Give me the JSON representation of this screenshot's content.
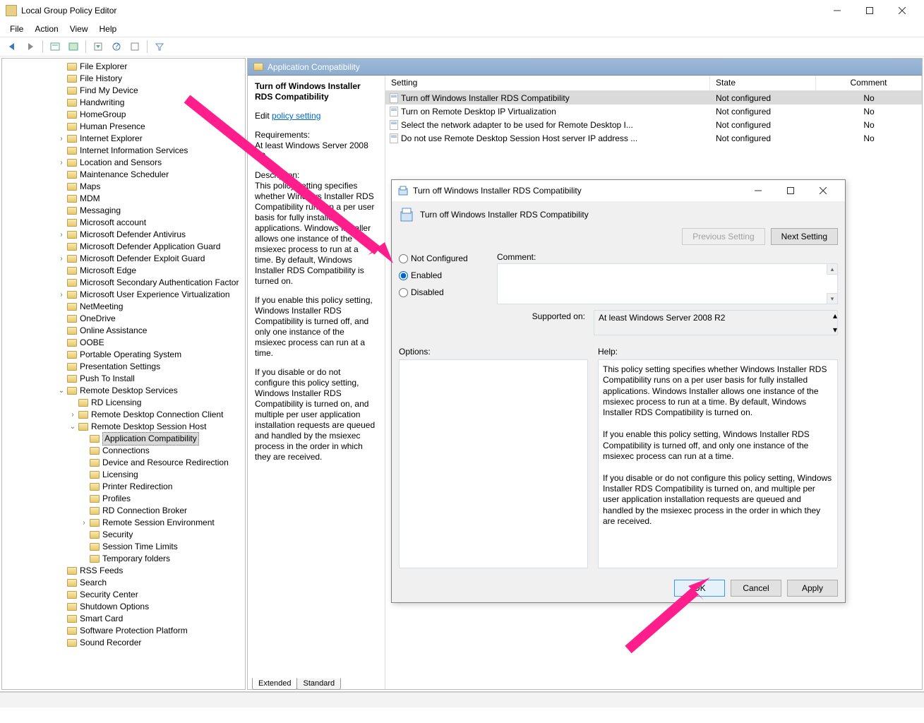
{
  "window": {
    "title": "Local Group Policy Editor"
  },
  "menu": [
    "File",
    "Action",
    "View",
    "Help"
  ],
  "header": {
    "title": "Application Compatibility"
  },
  "tree": [
    {
      "d": 3,
      "c": "",
      "l": "File Explorer"
    },
    {
      "d": 3,
      "c": "",
      "l": "File History"
    },
    {
      "d": 3,
      "c": "",
      "l": "Find My Device"
    },
    {
      "d": 3,
      "c": "",
      "l": "Handwriting"
    },
    {
      "d": 3,
      "c": "",
      "l": "HomeGroup"
    },
    {
      "d": 3,
      "c": "",
      "l": "Human Presence"
    },
    {
      "d": 3,
      "c": ">",
      "l": "Internet Explorer"
    },
    {
      "d": 3,
      "c": "",
      "l": "Internet Information Services"
    },
    {
      "d": 3,
      "c": ">",
      "l": "Location and Sensors"
    },
    {
      "d": 3,
      "c": "",
      "l": "Maintenance Scheduler"
    },
    {
      "d": 3,
      "c": "",
      "l": "Maps"
    },
    {
      "d": 3,
      "c": "",
      "l": "MDM"
    },
    {
      "d": 3,
      "c": "",
      "l": "Messaging"
    },
    {
      "d": 3,
      "c": "",
      "l": "Microsoft account"
    },
    {
      "d": 3,
      "c": ">",
      "l": "Microsoft Defender Antivirus"
    },
    {
      "d": 3,
      "c": "",
      "l": "Microsoft Defender Application Guard"
    },
    {
      "d": 3,
      "c": ">",
      "l": "Microsoft Defender Exploit Guard"
    },
    {
      "d": 3,
      "c": "",
      "l": "Microsoft Edge"
    },
    {
      "d": 3,
      "c": "",
      "l": "Microsoft Secondary Authentication Factor"
    },
    {
      "d": 3,
      "c": ">",
      "l": "Microsoft User Experience Virtualization"
    },
    {
      "d": 3,
      "c": "",
      "l": "NetMeeting"
    },
    {
      "d": 3,
      "c": "",
      "l": "OneDrive"
    },
    {
      "d": 3,
      "c": "",
      "l": "Online Assistance"
    },
    {
      "d": 3,
      "c": "",
      "l": "OOBE"
    },
    {
      "d": 3,
      "c": "",
      "l": "Portable Operating System"
    },
    {
      "d": 3,
      "c": "",
      "l": "Presentation Settings"
    },
    {
      "d": 3,
      "c": "",
      "l": "Push To Install"
    },
    {
      "d": 3,
      "c": "v",
      "l": "Remote Desktop Services"
    },
    {
      "d": 4,
      "c": "",
      "l": "RD Licensing"
    },
    {
      "d": 4,
      "c": ">",
      "l": "Remote Desktop Connection Client"
    },
    {
      "d": 4,
      "c": "v",
      "l": "Remote Desktop Session Host"
    },
    {
      "d": 5,
      "c": "",
      "l": "Application Compatibility",
      "sel": true
    },
    {
      "d": 5,
      "c": "",
      "l": "Connections"
    },
    {
      "d": 5,
      "c": "",
      "l": "Device and Resource Redirection"
    },
    {
      "d": 5,
      "c": "",
      "l": "Licensing"
    },
    {
      "d": 5,
      "c": "",
      "l": "Printer Redirection"
    },
    {
      "d": 5,
      "c": "",
      "l": "Profiles"
    },
    {
      "d": 5,
      "c": "",
      "l": "RD Connection Broker"
    },
    {
      "d": 5,
      "c": ">",
      "l": "Remote Session Environment"
    },
    {
      "d": 5,
      "c": "",
      "l": "Security"
    },
    {
      "d": 5,
      "c": "",
      "l": "Session Time Limits"
    },
    {
      "d": 5,
      "c": "",
      "l": "Temporary folders"
    },
    {
      "d": 3,
      "c": "",
      "l": "RSS Feeds"
    },
    {
      "d": 3,
      "c": "",
      "l": "Search"
    },
    {
      "d": 3,
      "c": "",
      "l": "Security Center"
    },
    {
      "d": 3,
      "c": "",
      "l": "Shutdown Options"
    },
    {
      "d": 3,
      "c": "",
      "l": "Smart Card"
    },
    {
      "d": 3,
      "c": "",
      "l": "Software Protection Platform"
    },
    {
      "d": 3,
      "c": "",
      "l": "Sound Recorder"
    }
  ],
  "columns": {
    "setting": "Setting",
    "state": "State",
    "comment": "Comment"
  },
  "rows": [
    {
      "name": "Turn off Windows Installer RDS Compatibility",
      "state": "Not configured",
      "comment": "No",
      "sel": true
    },
    {
      "name": "Turn on Remote Desktop IP Virtualization",
      "state": "Not configured",
      "comment": "No"
    },
    {
      "name": "Select the network adapter to be used for Remote Desktop I...",
      "state": "Not configured",
      "comment": "No"
    },
    {
      "name": "Do not use Remote Desktop Session Host server IP address ...",
      "state": "Not configured",
      "comment": "No"
    }
  ],
  "desc": {
    "title": "Turn off Windows Installer RDS Compatibility",
    "edit": "Edit ",
    "link": "policy setting",
    "reqLabel": "Requirements:",
    "req": "At least Windows Server 2008 R2",
    "dlabel": "Description:",
    "d1": "This policy setting specifies whether Windows Installer RDS Compatibility runs on a per user basis for fully installed applications. Windows Installer allows one instance of the msiexec process to run at a time. By default, Windows Installer RDS Compatibility is turned on.",
    "d2": "If you enable this policy setting, Windows Installer RDS Compatibility is turned off, and only one instance of the msiexec process can run at a time.",
    "d3": "If you disable or do not configure this policy setting, Windows Installer RDS Compatibility is turned on, and multiple per user application installation requests are queued and handled by the msiexec process in the order in which they are received."
  },
  "tabs": {
    "extended": "Extended",
    "standard": "Standard"
  },
  "dialog": {
    "title": "Turn off Windows Installer RDS Compatibility",
    "name": "Turn off Windows Installer RDS Compatibility",
    "prev": "Previous Setting",
    "next": "Next Setting",
    "r_not": "Not Configured",
    "r_en": "Enabled",
    "r_dis": "Disabled",
    "commentLabel": "Comment:",
    "supportedLabel": "Supported on:",
    "supported": "At least Windows Server 2008 R2",
    "optionsLabel": "Options:",
    "helpLabel": "Help:",
    "help1": "This policy setting specifies whether Windows Installer RDS Compatibility runs on a per user basis for fully installed applications. Windows Installer allows one instance of the msiexec process to run at a time. By default, Windows Installer RDS Compatibility is turned on.",
    "help2": "If you enable this policy setting, Windows Installer RDS Compatibility is turned off, and only one instance of the msiexec process can run at a time.",
    "help3": "If you disable or do not configure this policy setting, Windows Installer RDS Compatibility is turned on, and multiple per user application installation requests are queued and handled by the msiexec process in the order in which they are received.",
    "ok": "OK",
    "cancel": "Cancel",
    "apply": "Apply"
  }
}
